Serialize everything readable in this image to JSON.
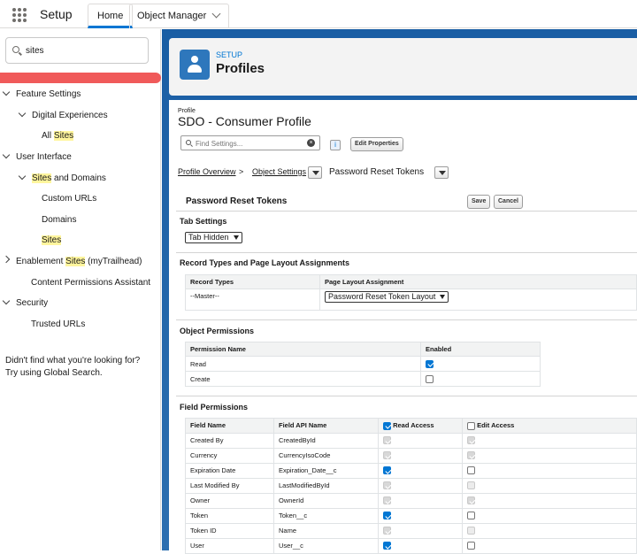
{
  "topbar": {
    "app_name": "Setup",
    "tabs": [
      {
        "label": "Home"
      },
      {
        "label": "Object Manager"
      }
    ]
  },
  "sidebar": {
    "search_value": "sites",
    "items": [
      {
        "label": "Feature Settings"
      },
      {
        "label": "Digital Experiences"
      },
      {
        "prefix": "All ",
        "highlight": "Sites"
      },
      {
        "label": "User Interface"
      },
      {
        "highlight": "Sites",
        "suffix": " and Domains"
      },
      {
        "label": "Custom URLs"
      },
      {
        "label": "Domains"
      },
      {
        "highlight": "Sites"
      },
      {
        "prefix": "Enablement ",
        "highlight": "Sites",
        "suffix": " (myTrailhead)"
      },
      {
        "label": "Content Permissions Assistant"
      },
      {
        "label": "Security"
      },
      {
        "label": "Trusted URLs"
      }
    ],
    "not_found_line1": "Didn't find what you're looking for?",
    "not_found_line2": "Try using Global Search."
  },
  "header": {
    "setup_label": "SETUP",
    "title": "Profiles"
  },
  "profile": {
    "small_label": "Profile",
    "name": "SDO - Consumer Profile",
    "find_placeholder": "Find Settings...",
    "info_label": "i",
    "edit_properties": "Edit Properties"
  },
  "breadcrumb": {
    "overview": "Profile Overview",
    "separator": ">",
    "object_settings": "Object Settings",
    "current": "Password Reset Tokens"
  },
  "section": {
    "title": "Password Reset Tokens",
    "save": "Save",
    "cancel": "Cancel"
  },
  "tab_settings": {
    "title": "Tab Settings",
    "value": "Tab Hidden"
  },
  "record_types": {
    "title": "Record Types and Page Layout Assignments",
    "col1": "Record Types",
    "col2": "Page Layout Assignment",
    "row_type": "--Master--",
    "row_layout": "Password Reset Token Layout"
  },
  "object_permissions": {
    "title": "Object Permissions",
    "col1": "Permission Name",
    "col2": "Enabled",
    "rows": [
      {
        "name": "Read",
        "enabled": true
      },
      {
        "name": "Create",
        "enabled": false
      }
    ]
  },
  "field_permissions": {
    "title": "Field Permissions",
    "col1": "Field Name",
    "col2": "Field API Name",
    "col3": "Read Access",
    "col4": "Edit Access",
    "rows": [
      {
        "name": "Created By",
        "api": "CreatedById",
        "read": true,
        "read_disabled": true,
        "edit": true,
        "edit_disabled": true
      },
      {
        "name": "Currency",
        "api": "CurrencyIsoCode",
        "read": true,
        "read_disabled": true,
        "edit": true,
        "edit_disabled": true
      },
      {
        "name": "Expiration Date",
        "api": "Expiration_Date__c",
        "read": true,
        "read_disabled": false,
        "edit": false,
        "edit_disabled": false
      },
      {
        "name": "Last Modified By",
        "api": "LastModifiedById",
        "read": true,
        "read_disabled": true,
        "edit": false,
        "edit_disabled": true
      },
      {
        "name": "Owner",
        "api": "OwnerId",
        "read": true,
        "read_disabled": true,
        "edit": true,
        "edit_disabled": true
      },
      {
        "name": "Token",
        "api": "Token__c",
        "read": true,
        "read_disabled": false,
        "edit": false,
        "edit_disabled": false
      },
      {
        "name": "Token ID",
        "api": "Name",
        "read": true,
        "read_disabled": true,
        "edit": false,
        "edit_disabled": true
      },
      {
        "name": "User",
        "api": "User__c",
        "read": true,
        "read_disabled": false,
        "edit": false,
        "edit_disabled": false
      }
    ]
  }
}
